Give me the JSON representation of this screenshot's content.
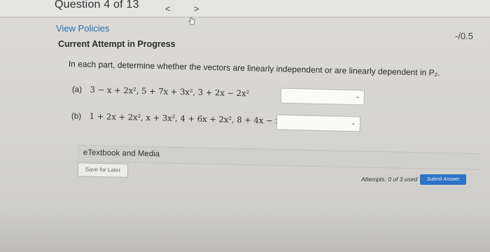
{
  "header": {
    "question_counter": "Question 4 of 13",
    "prev_icon": "chevron-left-icon",
    "next_icon": "chevron-right-icon",
    "prev_glyph": "<",
    "next_glyph": ">"
  },
  "policies": {
    "link_label": "View Policies"
  },
  "score": "-/0.5",
  "attempt": {
    "status": "Current Attempt in Progress"
  },
  "question": {
    "instructions": "In each part, determine whether the vectors are linearly independent or are linearly dependent in P₂.",
    "parts": [
      {
        "label": "(a)",
        "expression": "3 − x + 2x², 5 + 7x + 3x², 3 + 2x − 2x²",
        "selected_value": ""
      },
      {
        "label": "(b)",
        "expression": "1 + 2x + 2x², x + 3x², 4 + 6x + 2x², 8 + 4x − x²",
        "selected_value": ""
      }
    ]
  },
  "etextbook": {
    "label": "eTextbook and Media"
  },
  "footer": {
    "save_later_label": "Save for Later",
    "attempts_text": "Attempts: 0 of 3 used",
    "submit_label": "Submit Answer"
  },
  "colors": {
    "link": "#2a6fb5",
    "submit_bg": "#2d72c4"
  }
}
